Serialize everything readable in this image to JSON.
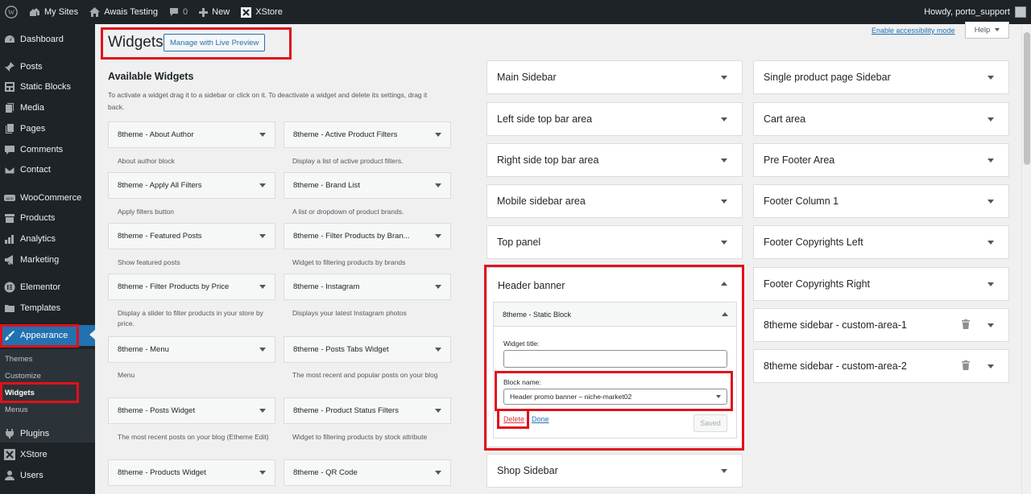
{
  "adminbar": {
    "my_sites": "My Sites",
    "site_name": "Awais Testing",
    "comments_count": "0",
    "new_label": "New",
    "xstore": "XStore",
    "howdy": "Howdy, porto_support"
  },
  "sidebar": {
    "items": [
      {
        "label": "Dashboard",
        "icon": "dashboard-icon"
      },
      {
        "label": "Posts",
        "icon": "pin-icon"
      },
      {
        "label": "Static Blocks",
        "icon": "blocks-icon"
      },
      {
        "label": "Media",
        "icon": "media-icon"
      },
      {
        "label": "Pages",
        "icon": "page-icon"
      },
      {
        "label": "Comments",
        "icon": "comment-icon"
      },
      {
        "label": "Contact",
        "icon": "mail-icon"
      },
      {
        "label": "WooCommerce",
        "icon": "woo-icon"
      },
      {
        "label": "Products",
        "icon": "archive-icon"
      },
      {
        "label": "Analytics",
        "icon": "chart-icon"
      },
      {
        "label": "Marketing",
        "icon": "megaphone-icon"
      },
      {
        "label": "Elementor",
        "icon": "elementor-icon"
      },
      {
        "label": "Templates",
        "icon": "folder-icon"
      },
      {
        "label": "Appearance",
        "icon": "brush-icon"
      },
      {
        "label": "Plugins",
        "icon": "plugin-icon"
      },
      {
        "label": "XStore",
        "icon": "xstore-icon"
      },
      {
        "label": "Users",
        "icon": "user-icon"
      }
    ],
    "submenu": [
      "Themes",
      "Customize",
      "Widgets",
      "Menus"
    ],
    "active_color": "#2271b1"
  },
  "header": {
    "title": "Widgets",
    "live_preview": "Manage with Live Preview",
    "accessibility": "Enable accessibility mode",
    "help": "Help"
  },
  "available": {
    "title": "Available Widgets",
    "description": "To activate a widget drag it to a sidebar or click on it. To deactivate a widget and delete its settings, drag it back.",
    "widgets": [
      {
        "name": "8theme - About Author",
        "desc": "About author block"
      },
      {
        "name": "8theme - Active Product Filters",
        "desc": "Display a list of active product filters."
      },
      {
        "name": "8theme - Apply All Filters",
        "desc": "Apply filters button"
      },
      {
        "name": "8theme - Brand List",
        "desc": "A list or dropdown of product brands."
      },
      {
        "name": "8theme - Featured Posts",
        "desc": "Show featured posts"
      },
      {
        "name": "8theme - Filter Products by Bran...",
        "desc": "Widget to filtering products by brands"
      },
      {
        "name": "8theme - Filter Products by Price",
        "desc": "Display a slider to filter products in your store by price."
      },
      {
        "name": "8theme - Instagram",
        "desc": "Displays your latest Instagram photos"
      },
      {
        "name": "8theme - Menu",
        "desc": "Menu"
      },
      {
        "name": "8theme - Posts Tabs Widget",
        "desc": "The most recent and popular posts on your blog"
      },
      {
        "name": "8theme - Posts Widget",
        "desc": "The most recent posts on your blog (Etheme Edit)"
      },
      {
        "name": "8theme - Product Status Filters",
        "desc": "Widget to filtering products by stock attribute"
      },
      {
        "name": "8theme - Products Widget",
        "desc": ""
      },
      {
        "name": "8theme - QR Code",
        "desc": ""
      }
    ]
  },
  "sidebars_left": [
    "Main Sidebar",
    "Left side top bar area",
    "Right side top bar area",
    "Mobile sidebar area",
    "Top panel",
    "Header banner",
    "Shop Sidebar"
  ],
  "sidebars_right": [
    "Single product page Sidebar",
    "Cart area",
    "Pre Footer Area",
    "Footer Column 1",
    "Footer Copyrights Left",
    "Footer Copyrights Right",
    "8theme sidebar - custom-area-1",
    "8theme sidebar - custom-area-2"
  ],
  "header_banner": {
    "widget_name": "8theme - Static Block",
    "widget_title_label": "Widget title:",
    "widget_title_value": "",
    "block_name_label": "Block name:",
    "block_name_value": "Header promo banner – niche-market02",
    "delete": "Delete",
    "done": "Done",
    "saved": "Saved"
  },
  "colors": {
    "highlight": "#e0111b",
    "link": "#2271b1",
    "delete": "#d63638"
  }
}
